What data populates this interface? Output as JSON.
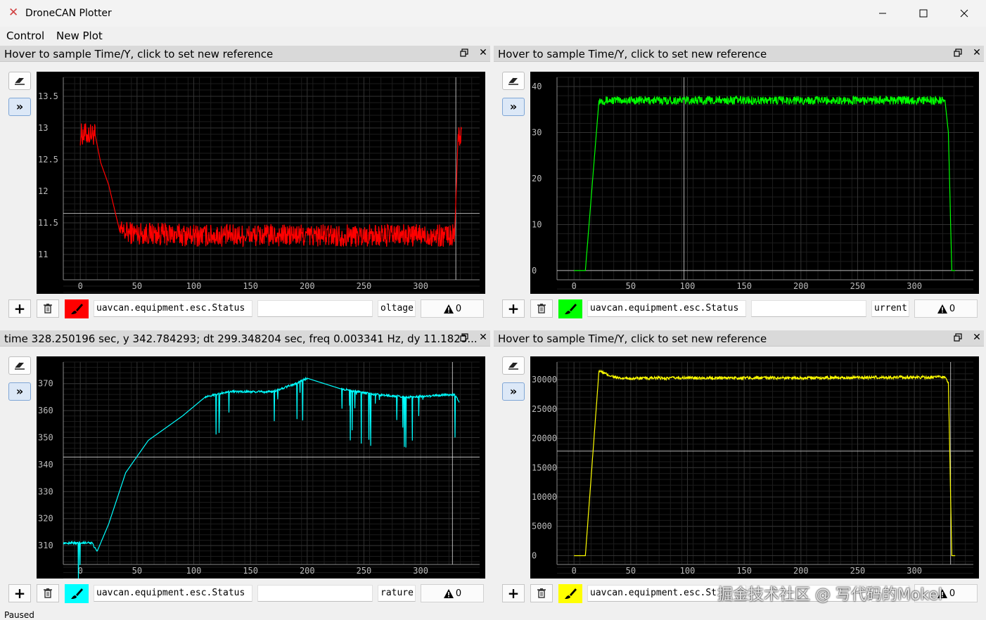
{
  "window": {
    "title": "DroneCAN Plotter"
  },
  "menu": {
    "items": [
      "Control",
      "New Plot"
    ]
  },
  "panels": [
    {
      "header": "Hover to sample Time/Y, click to set new reference",
      "message": "uavcan.equipment.esc.Status",
      "expression": "",
      "field": "oltage",
      "warn_count": "0",
      "color": "#ff0000",
      "chart_data": {
        "type": "line",
        "x": [
          0,
          330
        ],
        "xticks": [
          "0",
          "50",
          "100",
          "150",
          "200",
          "250",
          "300"
        ],
        "yticks": [
          "11",
          "11.5",
          "12",
          "12.5",
          "13",
          "13.5"
        ],
        "series": [
          {
            "color": "#ff0000",
            "points": [
              [
                0,
                12.9
              ],
              [
                13,
                12.9
              ],
              [
                18,
                12.45
              ],
              [
                25,
                12.1
              ],
              [
                35,
                11.35
              ],
              [
                100,
                11.3
              ],
              [
                200,
                11.3
              ],
              [
                330,
                11.3
              ],
              [
                333,
                12.9
              ],
              [
                336,
                12.9
              ]
            ]
          }
        ],
        "ylim": [
          10.6,
          13.8
        ],
        "reference_x": 331,
        "reference_y": 11.65
      }
    },
    {
      "header": "Hover to sample Time/Y, click to set new reference",
      "message": "uavcan.equipment.esc.Status",
      "expression": "",
      "field": "urrent",
      "warn_count": "0",
      "color": "#00ff00",
      "chart_data": {
        "type": "line",
        "x": [
          0,
          330
        ],
        "xticks": [
          "0",
          "50",
          "100",
          "150",
          "200",
          "250",
          "300"
        ],
        "yticks": [
          "0",
          "10",
          "20",
          "30",
          "40"
        ],
        "series": [
          {
            "color": "#00ff00",
            "points": [
              [
                0,
                0
              ],
              [
                10,
                0
              ],
              [
                22,
                37
              ],
              [
                327,
                37
              ],
              [
                330,
                30
              ],
              [
                333,
                0
              ],
              [
                336,
                0
              ]
            ]
          }
        ],
        "ylim": [
          -2,
          42
        ],
        "reference_x": 97,
        "reference_y": 0
      }
    },
    {
      "header": "time 328.250196 sec,  y 342.784293;    dt 299.348204 sec,  freq 0.003341 Hz,  dy 11.1828...",
      "message": "uavcan.equipment.esc.Status",
      "expression": "",
      "field": "rature",
      "warn_count": "0",
      "color": "#00ffff",
      "chart_data": {
        "type": "line",
        "x": [
          0,
          330
        ],
        "xticks": [
          "0",
          "50",
          "100",
          "150",
          "200",
          "250",
          "300"
        ],
        "yticks": [
          "310",
          "320",
          "330",
          "340",
          "350",
          "360",
          "370"
        ],
        "series": [
          {
            "color": "#00ffff",
            "points": [
              [
                -15,
                311
              ],
              [
                10,
                311
              ],
              [
                15,
                308
              ],
              [
                25,
                318
              ],
              [
                40,
                337
              ],
              [
                60,
                349
              ],
              [
                90,
                358
              ],
              [
                110,
                365
              ],
              [
                130,
                367
              ],
              [
                170,
                367
              ],
              [
                190,
                370
              ],
              [
                200,
                372
              ],
              [
                230,
                368
              ],
              [
                260,
                366
              ],
              [
                290,
                365
              ],
              [
                330,
                366
              ],
              [
                334,
                363
              ]
            ]
          }
        ],
        "ylim": [
          303,
          378
        ],
        "reference_x": 328,
        "reference_y": 342.8
      }
    },
    {
      "header": "Hover to sample Time/Y, click to set new reference",
      "message": "uavcan.equipment.esc.St",
      "expression": "",
      "field": "",
      "warn_count": "0",
      "color": "#ffff00",
      "chart_data": {
        "type": "line",
        "x": [
          0,
          330
        ],
        "xticks": [
          "0",
          "50",
          "100",
          "150",
          "200",
          "250",
          "300"
        ],
        "yticks": [
          "0",
          "5000",
          "10000",
          "15000",
          "20000",
          "25000",
          "30000"
        ],
        "series": [
          {
            "color": "#ffff00",
            "points": [
              [
                0,
                0
              ],
              [
                10,
                0
              ],
              [
                22,
                31500
              ],
              [
                30,
                30800
              ],
              [
                40,
                30200
              ],
              [
                100,
                30300
              ],
              [
                200,
                30300
              ],
              [
                320,
                30400
              ],
              [
                327,
                30400
              ],
              [
                330,
                29500
              ],
              [
                333,
                0
              ],
              [
                336,
                0
              ]
            ]
          }
        ],
        "ylim": [
          -1500,
          33000
        ],
        "reference_x": 332,
        "reference_y": 17800
      }
    }
  ],
  "watermark": "掘金技术社区 @ 写代码的Mokel",
  "status": "Paused"
}
